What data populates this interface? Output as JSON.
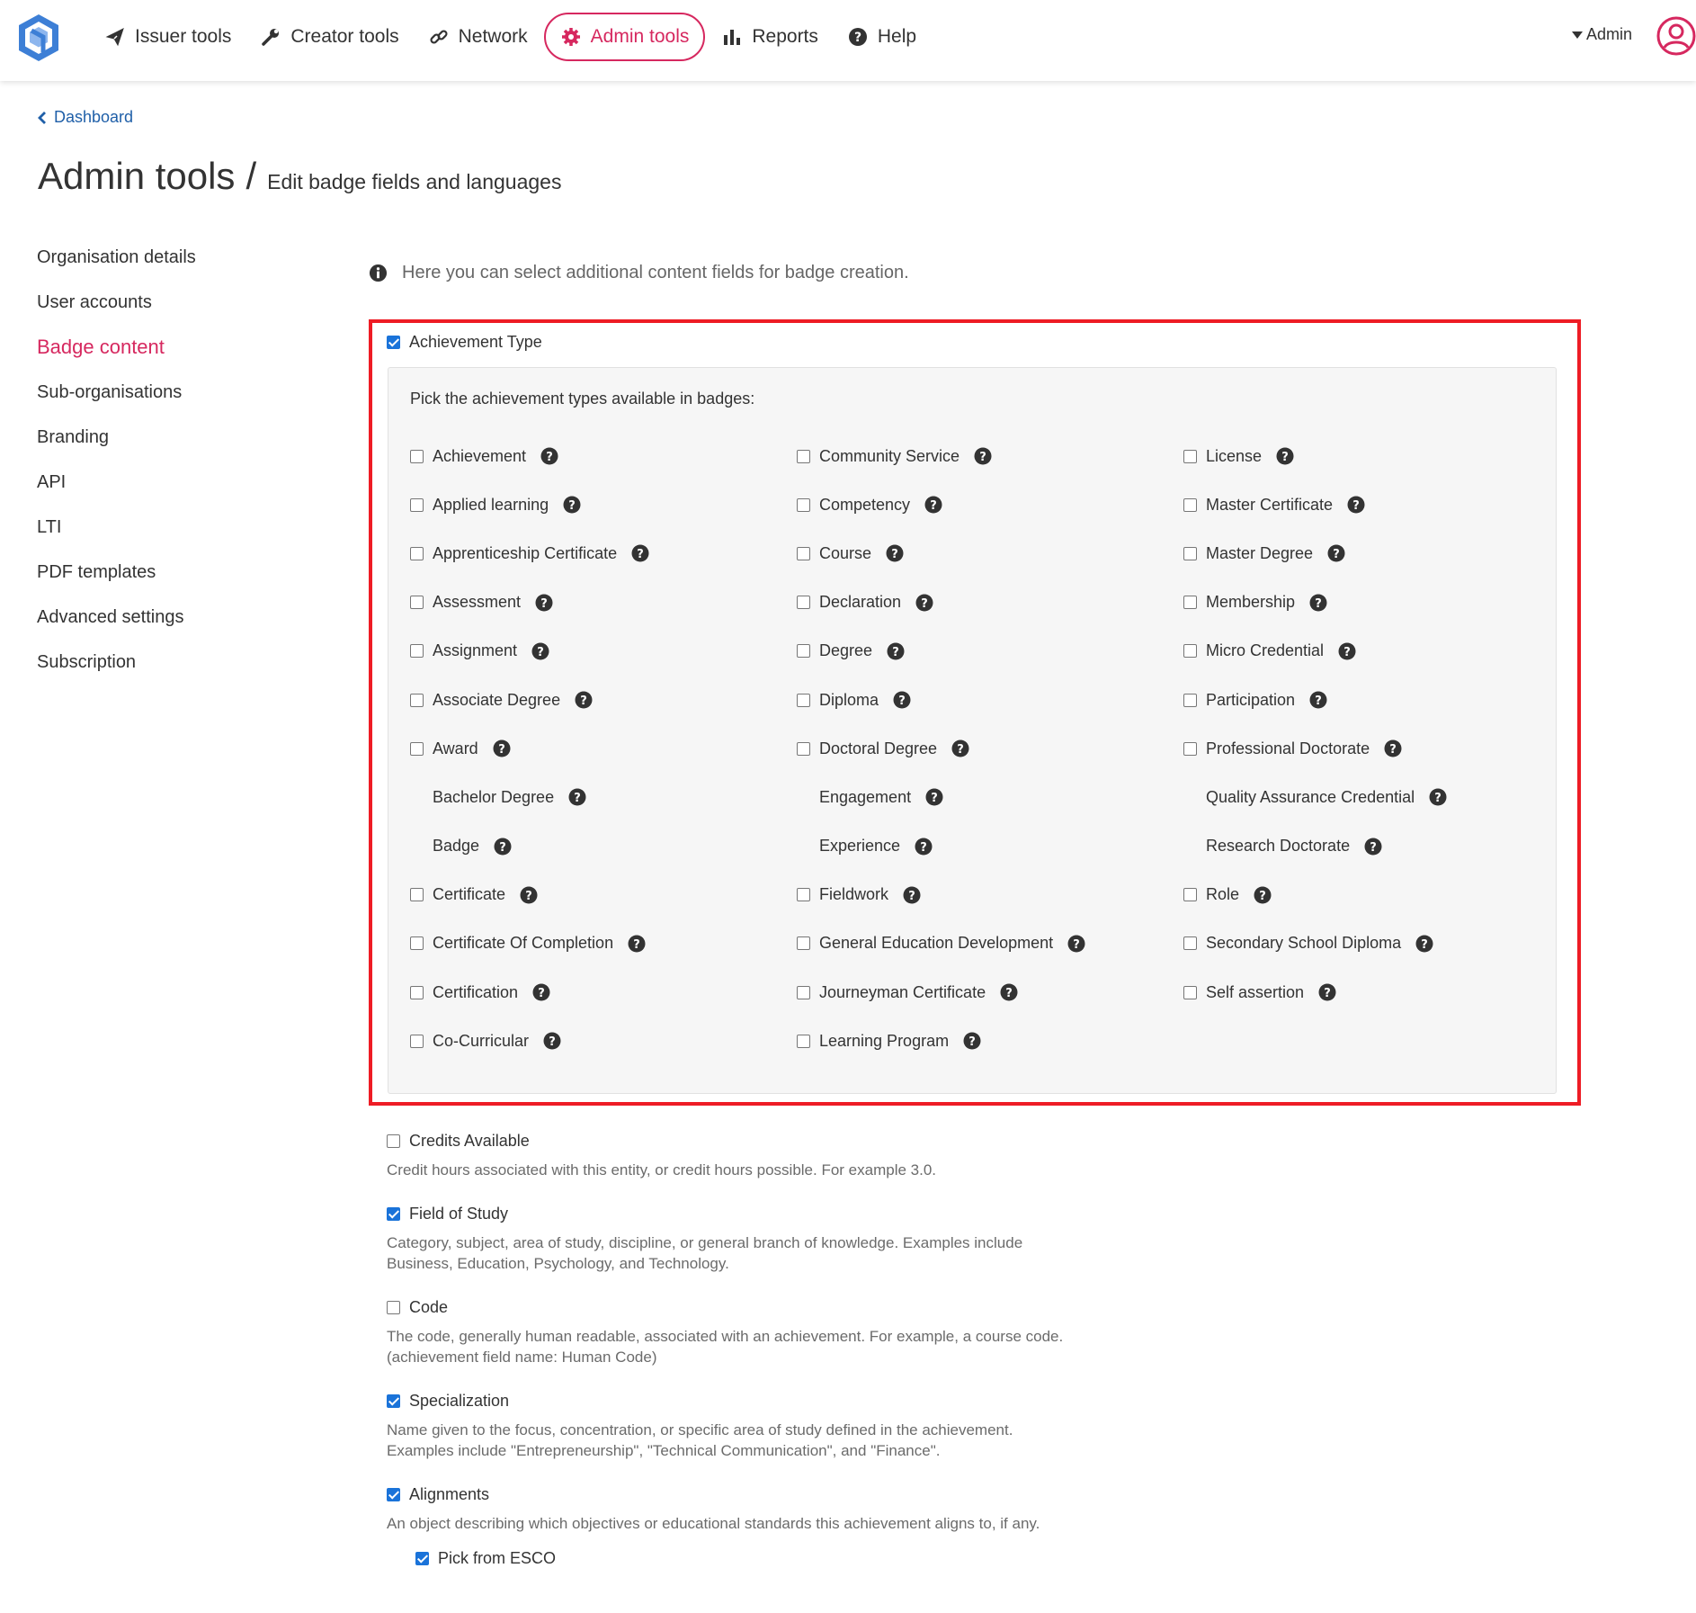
{
  "nav": {
    "items": [
      {
        "label": "Issuer tools",
        "icon": "paper-plane-icon",
        "active": false
      },
      {
        "label": "Creator tools",
        "icon": "wrench-icon",
        "active": false
      },
      {
        "label": "Network",
        "icon": "link-icon",
        "active": false
      },
      {
        "label": "Admin tools",
        "icon": "gear-icon",
        "active": true
      },
      {
        "label": "Reports",
        "icon": "bar-chart-icon",
        "active": false
      },
      {
        "label": "Help",
        "icon": "question-circle-icon",
        "active": false
      }
    ],
    "user_label": "Admin"
  },
  "breadcrumb": {
    "back_label": "Dashboard"
  },
  "page": {
    "title": "Admin tools",
    "separator": "/",
    "subtitle": "Edit badge fields and languages"
  },
  "sidebar": {
    "items": [
      {
        "label": "Organisation details",
        "active": false
      },
      {
        "label": "User accounts",
        "active": false
      },
      {
        "label": "Badge content",
        "active": true
      },
      {
        "label": "Sub-organisations",
        "active": false
      },
      {
        "label": "Branding",
        "active": false
      },
      {
        "label": "API",
        "active": false
      },
      {
        "label": "LTI",
        "active": false
      },
      {
        "label": "PDF templates",
        "active": false
      },
      {
        "label": "Advanced settings",
        "active": false
      },
      {
        "label": "Subscription",
        "active": false
      }
    ]
  },
  "info_text": "Here you can select additional content fields for badge creation.",
  "achievement_type": {
    "label": "Achievement Type",
    "checked": true,
    "prompt": "Pick the achievement types available in badges:",
    "types": [
      {
        "label": "Achievement",
        "checkbox": true
      },
      {
        "label": "Applied learning",
        "checkbox": true
      },
      {
        "label": "Apprenticeship Certificate",
        "checkbox": true
      },
      {
        "label": "Assessment",
        "checkbox": true
      },
      {
        "label": "Assignment",
        "checkbox": true
      },
      {
        "label": "Associate Degree",
        "checkbox": true
      },
      {
        "label": "Award",
        "checkbox": true
      },
      {
        "label": "Bachelor Degree",
        "checkbox": false
      },
      {
        "label": "Badge",
        "checkbox": false
      },
      {
        "label": "Certificate",
        "checkbox": true
      },
      {
        "label": "Certificate Of Completion",
        "checkbox": true
      },
      {
        "label": "Certification",
        "checkbox": true
      },
      {
        "label": "Co-Curricular",
        "checkbox": true
      },
      {
        "label": "Community Service",
        "checkbox": true
      },
      {
        "label": "Competency",
        "checkbox": true
      },
      {
        "label": "Course",
        "checkbox": true
      },
      {
        "label": "Declaration",
        "checkbox": true
      },
      {
        "label": "Degree",
        "checkbox": true
      },
      {
        "label": "Diploma",
        "checkbox": true
      },
      {
        "label": "Doctoral Degree",
        "checkbox": true
      },
      {
        "label": "Engagement",
        "checkbox": false
      },
      {
        "label": "Experience",
        "checkbox": false
      },
      {
        "label": "Fieldwork",
        "checkbox": true
      },
      {
        "label": "General Education Development",
        "checkbox": true
      },
      {
        "label": "Journeyman Certificate",
        "checkbox": true
      },
      {
        "label": "Learning Program",
        "checkbox": true
      },
      {
        "label": "License",
        "checkbox": true
      },
      {
        "label": "Master Certificate",
        "checkbox": true
      },
      {
        "label": "Master Degree",
        "checkbox": true
      },
      {
        "label": "Membership",
        "checkbox": true
      },
      {
        "label": "Micro Credential",
        "checkbox": true
      },
      {
        "label": "Participation",
        "checkbox": true
      },
      {
        "label": "Professional Doctorate",
        "checkbox": true
      },
      {
        "label": "Quality Assurance Credential",
        "checkbox": false
      },
      {
        "label": "Research Doctorate",
        "checkbox": false
      },
      {
        "label": "Role",
        "checkbox": true
      },
      {
        "label": "Secondary School Diploma",
        "checkbox": true
      },
      {
        "label": "Self assertion",
        "checkbox": true
      }
    ]
  },
  "options": [
    {
      "label": "Credits Available",
      "checked": false,
      "description": "Credit hours associated with this entity, or credit hours possible. For example 3.0."
    },
    {
      "label": "Field of Study",
      "checked": true,
      "description": "Category, subject, area of study, discipline, or general branch of knowledge. Examples include\nBusiness, Education, Psychology, and Technology."
    },
    {
      "label": "Code",
      "checked": false,
      "description": "The code, generally human readable, associated with an achievement. For example, a course code.\n(achievement field name: Human Code)"
    },
    {
      "label": "Specialization",
      "checked": true,
      "description": "Name given to the focus, concentration, or specific area of study defined in the achievement.\nExamples include \"Entrepreneurship\", \"Technical Communication\", and \"Finance\"."
    },
    {
      "label": "Alignments",
      "checked": true,
      "description": "An object describing which objectives or educational standards this achievement aligns to, if any."
    }
  ],
  "sub_option": {
    "label": "Pick from ESCO",
    "checked": true
  },
  "colors": {
    "accent": "#d6285f",
    "link": "#1f5fa8",
    "checkbox": "#1a73d9",
    "highlight": "#ee1c25"
  }
}
